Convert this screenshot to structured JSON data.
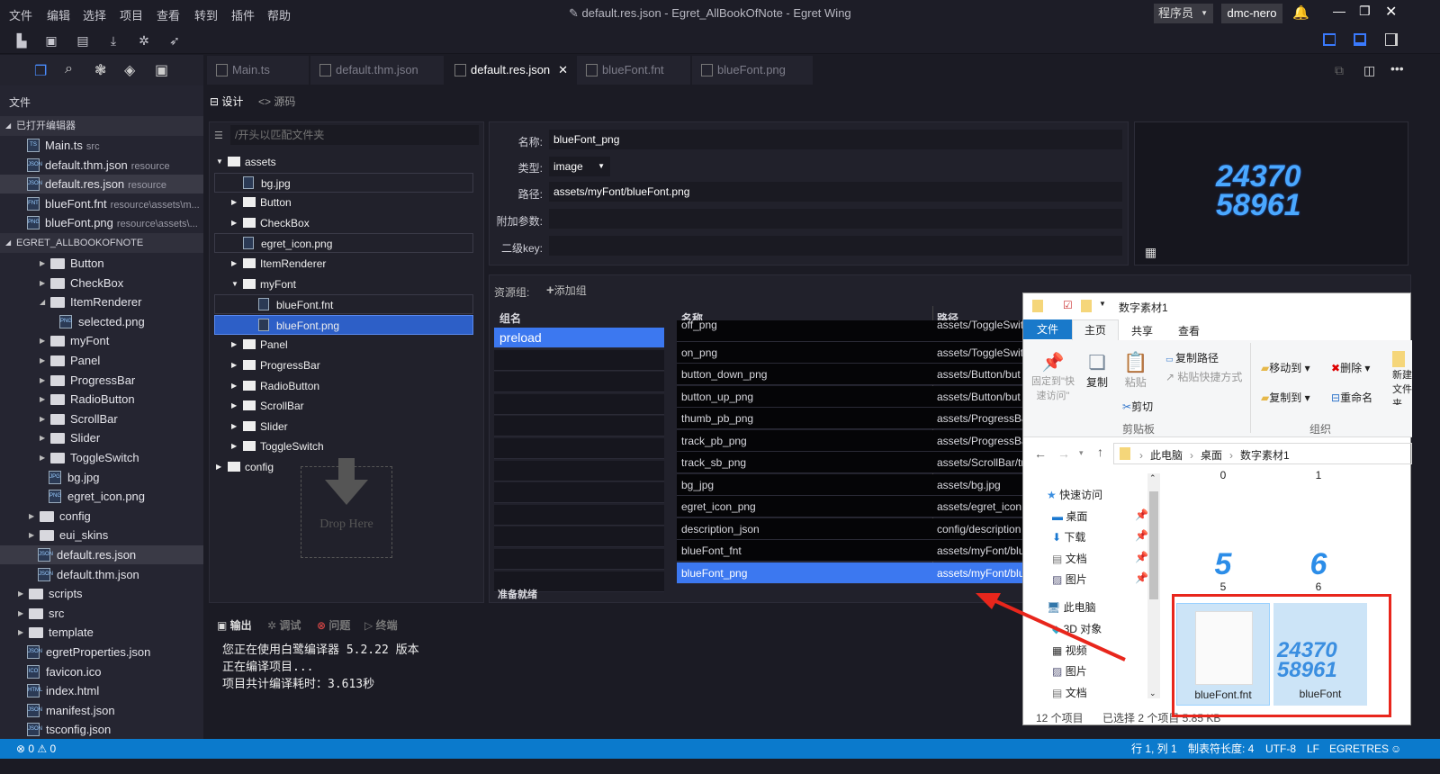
{
  "titlebar": {
    "menus": [
      "文件",
      "编辑",
      "选择",
      "项目",
      "查看",
      "转到",
      "插件",
      "帮助"
    ],
    "title": "default.res.json - Egret_AllBookOfNote - Egret Wing",
    "role": "程序员",
    "user": "dmc-nero"
  },
  "tabs": [
    {
      "label": "Main.ts",
      "icon": "ts"
    },
    {
      "label": "default.thm.json",
      "icon": "json"
    },
    {
      "label": "default.res.json",
      "icon": "json",
      "active": true
    },
    {
      "label": "blueFont.fnt",
      "icon": "fnt"
    },
    {
      "label": "blueFont.png",
      "icon": "png"
    }
  ],
  "sidebar": {
    "title": "文件",
    "open_editors_title": "已打开编辑器",
    "open_editors": [
      {
        "name": "Main.ts",
        "hint": "src",
        "icon": "TS"
      },
      {
        "name": "default.thm.json",
        "hint": "resource",
        "icon": "JSON"
      },
      {
        "name": "default.res.json",
        "hint": "resource",
        "icon": "JSON",
        "selected": true
      },
      {
        "name": "blueFont.fnt",
        "hint": "resource\\assets\\m...",
        "icon": "FNT"
      },
      {
        "name": "blueFont.png",
        "hint": "resource\\assets\\...",
        "icon": "PNG"
      }
    ],
    "project_title": "EGRET_ALLBOOKOFNOTE",
    "tree": [
      {
        "name": "Button",
        "d": 2,
        "t": "folder"
      },
      {
        "name": "CheckBox",
        "d": 2,
        "t": "folder"
      },
      {
        "name": "ItemRenderer",
        "d": 2,
        "t": "folder",
        "open": true
      },
      {
        "name": "selected.png",
        "d": 3,
        "t": "file",
        "icon": "PNG"
      },
      {
        "name": "myFont",
        "d": 2,
        "t": "folder"
      },
      {
        "name": "Panel",
        "d": 2,
        "t": "folder"
      },
      {
        "name": "ProgressBar",
        "d": 2,
        "t": "folder"
      },
      {
        "name": "RadioButton",
        "d": 2,
        "t": "folder"
      },
      {
        "name": "ScrollBar",
        "d": 2,
        "t": "folder"
      },
      {
        "name": "Slider",
        "d": 2,
        "t": "folder"
      },
      {
        "name": "ToggleSwitch",
        "d": 2,
        "t": "folder"
      },
      {
        "name": "bg.jpg",
        "d": 2,
        "t": "file",
        "icon": "JPG"
      },
      {
        "name": "egret_icon.png",
        "d": 2,
        "t": "file",
        "icon": "PNG"
      },
      {
        "name": "config",
        "d": 1,
        "t": "folder"
      },
      {
        "name": "eui_skins",
        "d": 1,
        "t": "folder"
      },
      {
        "name": "default.res.json",
        "d": 1,
        "t": "file",
        "icon": "JSON",
        "selected": true
      },
      {
        "name": "default.thm.json",
        "d": 1,
        "t": "file",
        "icon": "JSON"
      },
      {
        "name": "scripts",
        "d": 0,
        "t": "folder"
      },
      {
        "name": "src",
        "d": 0,
        "t": "folder"
      },
      {
        "name": "template",
        "d": 0,
        "t": "folder"
      },
      {
        "name": "egretProperties.json",
        "d": 0,
        "t": "file",
        "icon": "JSON"
      },
      {
        "name": "favicon.ico",
        "d": 0,
        "t": "file",
        "icon": "ICO"
      },
      {
        "name": "index.html",
        "d": 0,
        "t": "file",
        "icon": "HTML"
      },
      {
        "name": "manifest.json",
        "d": 0,
        "t": "file",
        "icon": "JSON"
      },
      {
        "name": "tsconfig.json",
        "d": 0,
        "t": "file",
        "icon": "JSON"
      }
    ]
  },
  "editor": {
    "design_tab": "设计",
    "source_tab": "源码",
    "filter_placeholder": "/开头以匹配文件夹",
    "asset_tree": [
      {
        "name": "assets",
        "d": 0,
        "t": "folder",
        "open": true
      },
      {
        "name": "bg.jpg",
        "d": 1,
        "t": "file",
        "box": true
      },
      {
        "name": "Button",
        "d": 1,
        "t": "folder"
      },
      {
        "name": "CheckBox",
        "d": 1,
        "t": "folder"
      },
      {
        "name": "egret_icon.png",
        "d": 1,
        "t": "file",
        "box": true
      },
      {
        "name": "ItemRenderer",
        "d": 1,
        "t": "folder"
      },
      {
        "name": "myFont",
        "d": 1,
        "t": "folder",
        "open": true
      },
      {
        "name": "blueFont.fnt",
        "d": 2,
        "t": "file",
        "box": true
      },
      {
        "name": "blueFont.png",
        "d": 2,
        "t": "file",
        "selected": true
      },
      {
        "name": "Panel",
        "d": 1,
        "t": "folder"
      },
      {
        "name": "ProgressBar",
        "d": 1,
        "t": "folder"
      },
      {
        "name": "RadioButton",
        "d": 1,
        "t": "folder"
      },
      {
        "name": "ScrollBar",
        "d": 1,
        "t": "folder"
      },
      {
        "name": "Slider",
        "d": 1,
        "t": "folder"
      },
      {
        "name": "ToggleSwitch",
        "d": 1,
        "t": "folder"
      },
      {
        "name": "config",
        "d": 0,
        "t": "folder"
      }
    ],
    "drop_here": "Drop Here",
    "props": {
      "name_label": "名称:",
      "name_value": "blueFont_png",
      "type_label": "类型:",
      "type_value": "image",
      "path_label": "路径:",
      "path_value": "assets/myFont/blueFont.png",
      "extra_label": "附加参数:",
      "extra_value": "",
      "subkey_label": "二级key:",
      "subkey_value": ""
    },
    "preview_text": [
      "24370",
      "58961"
    ],
    "res_group_label": "资源组:",
    "add_group": "添加组",
    "group_header": "组名",
    "groups": [
      "preload"
    ],
    "name_header": "名称",
    "path_header": "路径",
    "resources": [
      {
        "name": "off_png",
        "path": "assets/ToggleSwitc"
      },
      {
        "name": "on_png",
        "path": "assets/ToggleSwitc"
      },
      {
        "name": "button_down_png",
        "path": "assets/Button/but"
      },
      {
        "name": "button_up_png",
        "path": "assets/Button/but"
      },
      {
        "name": "thumb_pb_png",
        "path": "assets/ProgressBa"
      },
      {
        "name": "track_pb_png",
        "path": "assets/ProgressBa"
      },
      {
        "name": "track_sb_png",
        "path": "assets/ScrollBar/tr"
      },
      {
        "name": "bg_jpg",
        "path": "assets/bg.jpg"
      },
      {
        "name": "egret_icon_png",
        "path": "assets/egret_icon.p"
      },
      {
        "name": "description_json",
        "path": "config/description"
      },
      {
        "name": "blueFont_fnt",
        "path": "assets/myFont/blu"
      },
      {
        "name": "blueFont_png",
        "path": "assets/myFont/blu",
        "selected": true
      }
    ],
    "ready": "准备就绪"
  },
  "output": {
    "tabs": [
      "输出",
      "调试",
      "问题",
      "终端"
    ],
    "lines": [
      "您正在使用白鹭编译器 5.2.22 版本",
      "正在编译项目...",
      "项目共计编译耗时：3.613秒"
    ]
  },
  "statusbar": {
    "errors": "0",
    "warnings": "0",
    "position": "行 1, 列 1",
    "tab_size": "制表符长度: 4",
    "encoding": "UTF-8",
    "eol": "LF",
    "mode": "EGRETRES"
  },
  "explorer": {
    "title": "数字素材1",
    "ribbon_tabs": [
      "文件",
      "主页",
      "共享",
      "查看"
    ],
    "pin": "固定到\"快速访问\"",
    "copy": "复制",
    "paste": "粘贴",
    "copy_path": "复制路径",
    "paste_shortcut": "粘贴快捷方式",
    "cut": "剪切",
    "clipboard": "剪贴板",
    "move_to": "移动到",
    "copy_to": "复制到",
    "delete": "删除",
    "rename": "重命名",
    "organize": "组织",
    "new": "新建文件夹",
    "breadcrumb": [
      "此电脑",
      "桌面",
      "数字素材1"
    ],
    "nav": [
      {
        "label": "快速访问",
        "d": 0
      },
      {
        "label": "桌面",
        "d": 1,
        "pin": true
      },
      {
        "label": "下载",
        "d": 1,
        "pin": true
      },
      {
        "label": "文档",
        "d": 1,
        "pin": true
      },
      {
        "label": "图片",
        "d": 1,
        "pin": true
      },
      {
        "label": "此电脑",
        "d": 0
      },
      {
        "label": "3D 对象",
        "d": 1
      },
      {
        "label": "视频",
        "d": 1
      },
      {
        "label": "图片",
        "d": 1
      },
      {
        "label": "文档",
        "d": 1
      }
    ],
    "thumbs": [
      "0",
      "1",
      "5",
      "6"
    ],
    "thumb_glyphs": [
      "5",
      "6"
    ],
    "files": [
      "blueFont.fnt",
      "blueFont"
    ],
    "item_count": "12 个项目",
    "selection": "已选择 2 个项目  5.85 KB"
  },
  "colors": {
    "accent": "#3c78f0",
    "status": "#0b7acc",
    "annotation": "#e8261c"
  }
}
